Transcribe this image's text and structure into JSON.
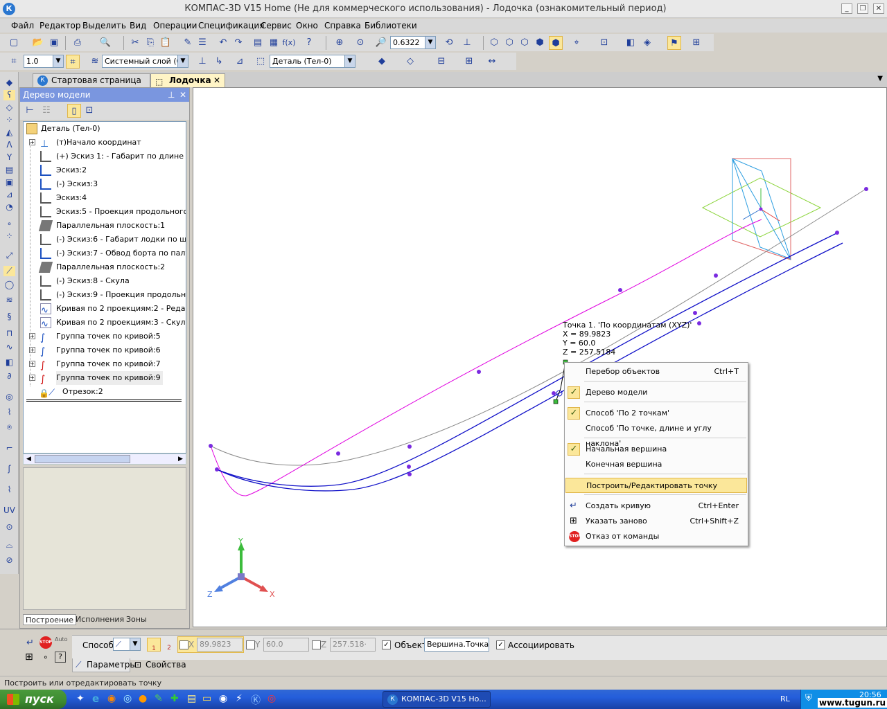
{
  "window": {
    "title": "КОМПАС-3D V15 Home (Не для коммерческого использования) - Лодочка (ознакомительный период)",
    "app_icon": "К"
  },
  "menu": [
    "Файл",
    "Редактор",
    "Выделить",
    "Вид",
    "Операции",
    "Спецификация",
    "Сервис",
    "Окно",
    "Справка",
    "Библиотеки"
  ],
  "toolbar": {
    "zoom_value": "0.6322",
    "step_value": "1.0",
    "layer_value": "Системный слой (0)",
    "part_value": "Деталь (Тел-0)"
  },
  "tabs": [
    {
      "label": "Стартовая страница"
    },
    {
      "label": "Лодочка"
    }
  ],
  "panel": {
    "title": "Дерево модели",
    "tree": [
      {
        "label": "Деталь (Тел-0)"
      },
      {
        "label": "(т)Начало координат"
      },
      {
        "label": "(+) Эскиз 1: - Габарит по длине и в"
      },
      {
        "label": "Эскиз:2"
      },
      {
        "label": "(-) Эскиз:3"
      },
      {
        "label": "Эскиз:4"
      },
      {
        "label": "Эскиз:5 - Проекция продольного ре"
      },
      {
        "label": "Параллельная плоскость:1"
      },
      {
        "label": "(-) Эскиз:6 - Габарит лодки по шири"
      },
      {
        "label": "(-) Эскиз:7 - Обвод борта по палубе"
      },
      {
        "label": "Параллельная плоскость:2"
      },
      {
        "label": "(-) Эскиз:8 - Скула"
      },
      {
        "label": "(-) Эскиз:9 - Проекция продольного"
      },
      {
        "label": "Кривая по 2 проекциям:2 - Редан"
      },
      {
        "label": "Кривая по 2 проекциям:3 - Скула"
      },
      {
        "label": "Группа точек по кривой:5"
      },
      {
        "label": "Группа точек по кривой:6"
      },
      {
        "label": "Группа точек по кривой:7"
      },
      {
        "label": "Группа точек по кривой:9"
      },
      {
        "label": "Отрезок:2"
      }
    ],
    "bottom_tabs": [
      "Построение",
      "Исполнения",
      "Зоны"
    ]
  },
  "tooltip": {
    "line1": "Точка 1. 'По координатам (XYZ)'",
    "line2": "X = 89.9823",
    "line3": "Y = 60.0",
    "line4": "Z = 257.5184"
  },
  "axes": {
    "x": "X",
    "y": "Y",
    "z": "Z"
  },
  "context_menu": [
    {
      "label": "Перебор объектов",
      "shortcut": "Ctrl+T"
    },
    {
      "label": "Дерево модели",
      "checked": true
    },
    {
      "label": "Способ 'По 2 точкам'",
      "checked": true
    },
    {
      "label": "Способ 'По точке, длине и углу наклона'"
    },
    {
      "label": "Начальная вершина",
      "checked": true
    },
    {
      "label": "Конечная вершина"
    },
    {
      "label": "Построить/Редактировать точку",
      "highlighted": true
    },
    {
      "label": "Создать кривую",
      "shortcut": "Ctrl+Enter"
    },
    {
      "label": "Указать заново",
      "shortcut": "Ctrl+Shift+Z"
    },
    {
      "label": "Отказ от команды"
    }
  ],
  "propbar": {
    "method_label": "Способ",
    "x_label": "X",
    "x_value": "89.9823",
    "y_label": "Y",
    "y_value": "60.0",
    "z_label": "Z",
    "z_value": "257.518·",
    "object_label": "Объект",
    "object_value": "Вершина.Точка (",
    "associate_label": "Ассоциировать",
    "tab_params": "Параметры",
    "tab_props": "Свойства",
    "stop_label": "STOP",
    "auto_label": "Auto",
    "btn1": "1",
    "btn2": "2"
  },
  "status": {
    "text": "Построить или отредактировать точку"
  },
  "taskbar": {
    "start": "пуск",
    "task": "КОМПАС-3D V15 Ho...",
    "lang": "RL",
    "clock": "20:56",
    "watermark": "www.tugun.ru"
  },
  "colors": {
    "accent": "#7a96df",
    "menu_highlight": "#fbe79a",
    "curve_magenta": "#e000e0",
    "curve_blue": "#1010c8",
    "curve_gray": "#8a8a8a"
  }
}
